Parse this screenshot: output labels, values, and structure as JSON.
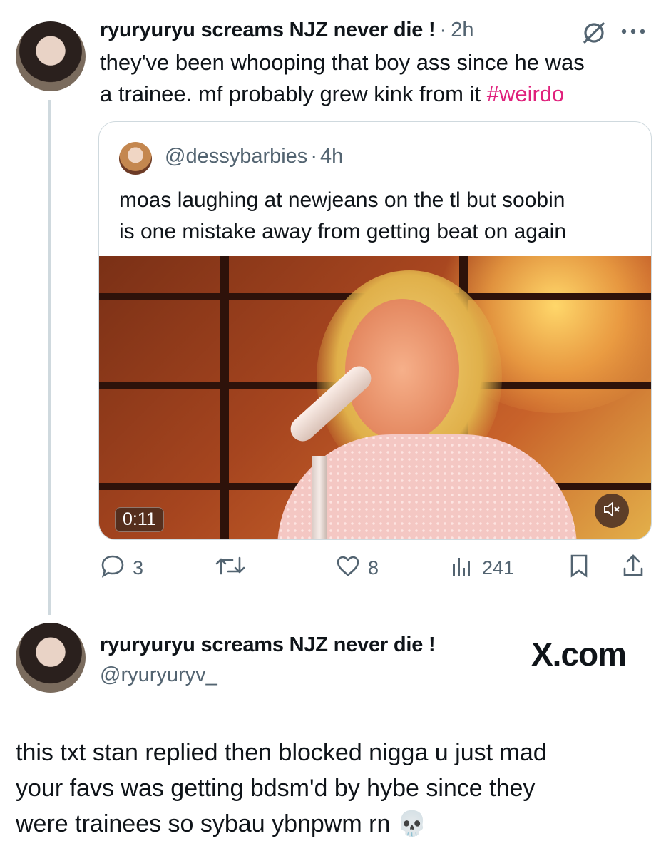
{
  "tweet": {
    "author_name": "ryuryuryu screams NJZ never die !",
    "separator": "·",
    "time": "2h",
    "text_line1": "they've been whooping that boy ass since he was",
    "text_line2": "a trainee. mf probably grew kink from it ",
    "hashtag": "#weirdo",
    "quote": {
      "handle": "@dessybarbies",
      "separator": "·",
      "time": "4h",
      "text_line1": "moas laughing at newjeans on the tl but soobin",
      "text_line2": "is one mistake away from getting beat on again",
      "video_duration": "0:11"
    },
    "actions": {
      "replies": "3",
      "likes": "8",
      "views": "241"
    }
  },
  "profile_card": {
    "name": "ryuryuryu screams NJZ never die !",
    "handle": "@ryuryuryv_",
    "brand": "X.com"
  },
  "caption": {
    "line1": "this txt stan replied then blocked nigga u just mad",
    "line2": "your favs was getting bdsm'd by hybe since they",
    "line3": "were trainees so sybau ybnpwm rn",
    "emoji": "💀"
  },
  "colors": {
    "hashtag": "#e0217c",
    "muted": "#536471",
    "border": "#cfd9de"
  },
  "icons": {
    "grok": "grok-icon",
    "more": "more-icon",
    "reply": "reply-icon",
    "retweet": "retweet-icon",
    "like": "like-icon",
    "views": "views-icon",
    "bookmark": "bookmark-icon",
    "share": "share-icon",
    "mute": "mute-icon"
  }
}
